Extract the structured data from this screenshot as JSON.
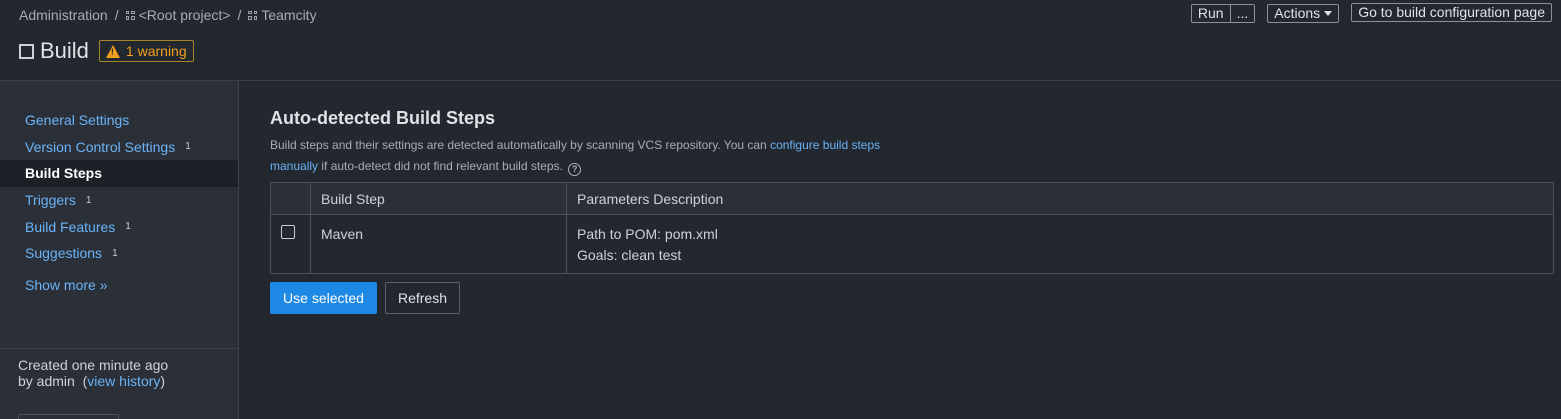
{
  "breadcrumb": {
    "items": [
      {
        "label": "Administration"
      },
      {
        "label": "<Root project>"
      },
      {
        "label": "Teamcity"
      }
    ],
    "separator": "/"
  },
  "header": {
    "title": "Build",
    "warning_badge": "1 warning",
    "actions": {
      "run_label": "Run",
      "run_more_label": "...",
      "actions_label": "Actions",
      "goto_label": "Go to build configuration page"
    }
  },
  "sidebar": {
    "items": [
      {
        "label": "General Settings",
        "count": ""
      },
      {
        "label": "Version Control Settings",
        "count": "1"
      },
      {
        "label": "Build Steps",
        "count": ""
      },
      {
        "label": "Triggers",
        "count": "1"
      },
      {
        "label": "Build Features",
        "count": "1"
      },
      {
        "label": "Suggestions",
        "count": "1"
      }
    ],
    "active_item": "Build Steps",
    "show_more": "Show more »",
    "created_line1": "Created one minute ago",
    "created_line2_prefix": "by admin",
    "view_history": "view history"
  },
  "main": {
    "section_title": "Auto-detected Build Steps",
    "description_part1": "Build steps and their settings are detected automatically by scanning VCS repository. You can ",
    "description_link": "configure build steps manually",
    "description_part2": " if auto-detect did not find relevant build steps.",
    "table": {
      "columns": [
        "",
        "Build Step",
        "Parameters Description"
      ],
      "rows": [
        {
          "selected": false,
          "step": "Maven",
          "params": [
            "Path to POM: pom.xml",
            "Goals: clean test"
          ]
        }
      ]
    },
    "use_selected_label": "Use selected",
    "refresh_label": "Refresh"
  },
  "colors": {
    "background": "#23272e",
    "sidebar": "#2b3038",
    "link": "#6ab3f7",
    "primary": "#1e88e5",
    "warning": "#f1a01e"
  }
}
